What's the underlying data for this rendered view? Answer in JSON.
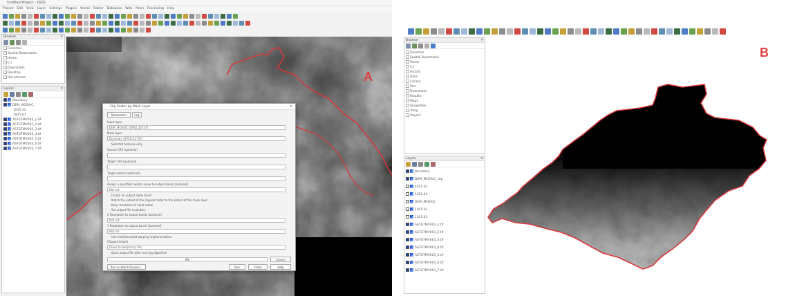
{
  "panel_a": {
    "label": "A",
    "window_title": "Untitled Project - QGIS",
    "menu": [
      "Project",
      "Edit",
      "View",
      "Layer",
      "Settings",
      "Plugins",
      "Vector",
      "Raster",
      "Database",
      "Web",
      "Mesh",
      "Processing",
      "Help"
    ],
    "browser_title": "Browser",
    "browser_items": [
      "Favorites",
      "Spatial Bookmarks",
      "Home",
      "C:\\",
      "Downloads",
      "Desktop",
      "Documents"
    ],
    "layers_title": "Layers",
    "layers": [
      {
        "name": "Boundary",
        "checked": true
      },
      {
        "name": "DEM_MOSAIC",
        "checked": true
      },
      {
        "name": "ASTGTMV003_1.tif",
        "checked": true
      },
      {
        "name": "ASTGTMV003_2.tif",
        "checked": true
      },
      {
        "name": "ASTGTMV003_3.tif",
        "checked": true
      },
      {
        "name": "ASTGTMV003_4.tif",
        "checked": true
      },
      {
        "name": "ASTGTMV003_5.tif",
        "checked": true
      },
      {
        "name": "ASTGTMV003_6.tif",
        "checked": true
      },
      {
        "name": "ASTGTMV003_7.tif",
        "checked": true
      }
    ],
    "legend_high": "1825.61",
    "legend_low": "1025.42",
    "dialog": {
      "title": "Clip Raster by Mask Layer",
      "tabs": [
        "Parameters",
        "Log"
      ],
      "input_layer_label": "Input layer",
      "input_layer_value": "DEM_MOSAIC [EPSG:32737]",
      "mask_layer_label": "Mask layer",
      "mask_layer_value": "Boundary [EPSG:32737]",
      "selected_only": "Selected features only",
      "source_crs_label": "Source CRS [optional]",
      "target_crs_label": "Target CRS [optional]",
      "extent_label": "Target extent [optional]",
      "nodata_label": "Assign a specified nodata value to output bands [optional]",
      "nodata_value": "Not set",
      "create_alpha": "Create an output alpha band",
      "match_extent": "Match the extent of the clipped raster to the extent of the mask layer",
      "keep_resolution": "Keep resolution of input raster",
      "set_resolution": "Set output file resolution",
      "x_res_label": "X Resolution to output bands [optional]",
      "x_res_value": "Not set",
      "y_res_label": "Y Resolution to output bands [optional]",
      "y_res_value": "Not set",
      "multithread": "Use multithreaded warping implementation",
      "clipped_label": "Clipped (mask)",
      "clipped_value": "[Save to temporary file]",
      "open_after": "Open output file after running algorithm",
      "progress": "0%",
      "cancel": "Cancel",
      "batch_button": "Run as Batch Process...",
      "run_button": "Run",
      "close_button": "Close",
      "help_button": "Help"
    }
  },
  "panel_b": {
    "label": "B",
    "browser_title": "Browser",
    "browser_items": [
      "Favorites",
      "Spatial Bookmarks",
      "Home",
      "C:\\",
      "ArcGIS",
      "Data",
      "Library",
      "Pad",
      "Downloads",
      "Results",
      "Maps",
      "Shapefiles",
      "Temp",
      "Project"
    ],
    "layers_title": "Layers",
    "layers": [
      {
        "name": "Boundary",
        "checked": true
      },
      {
        "name": "DEM_MOSAIC_clip",
        "checked": true
      },
      {
        "name": "1825.61",
        "checked": false
      },
      {
        "name": "1025.42",
        "checked": false
      },
      {
        "name": "DEM_MOSAIC",
        "checked": false
      },
      {
        "name": "1825.61",
        "checked": false
      },
      {
        "name": "1025.42",
        "checked": false
      },
      {
        "name": "ASTGTMV003_1.tif",
        "checked": true
      },
      {
        "name": "ASTGTMV003_2.tif",
        "checked": true
      },
      {
        "name": "ASTGTMV003_3.tif",
        "checked": true
      },
      {
        "name": "ASTGTMV003_4.tif",
        "checked": true
      },
      {
        "name": "ASTGTMV003_5.tif",
        "checked": true
      },
      {
        "name": "ASTGTMV003_6.tif",
        "checked": true
      },
      {
        "name": "ASTGTMV003_7.tif",
        "checked": true
      }
    ]
  },
  "colors": {
    "boundary": "#d8363a",
    "label": "#e0403f"
  }
}
